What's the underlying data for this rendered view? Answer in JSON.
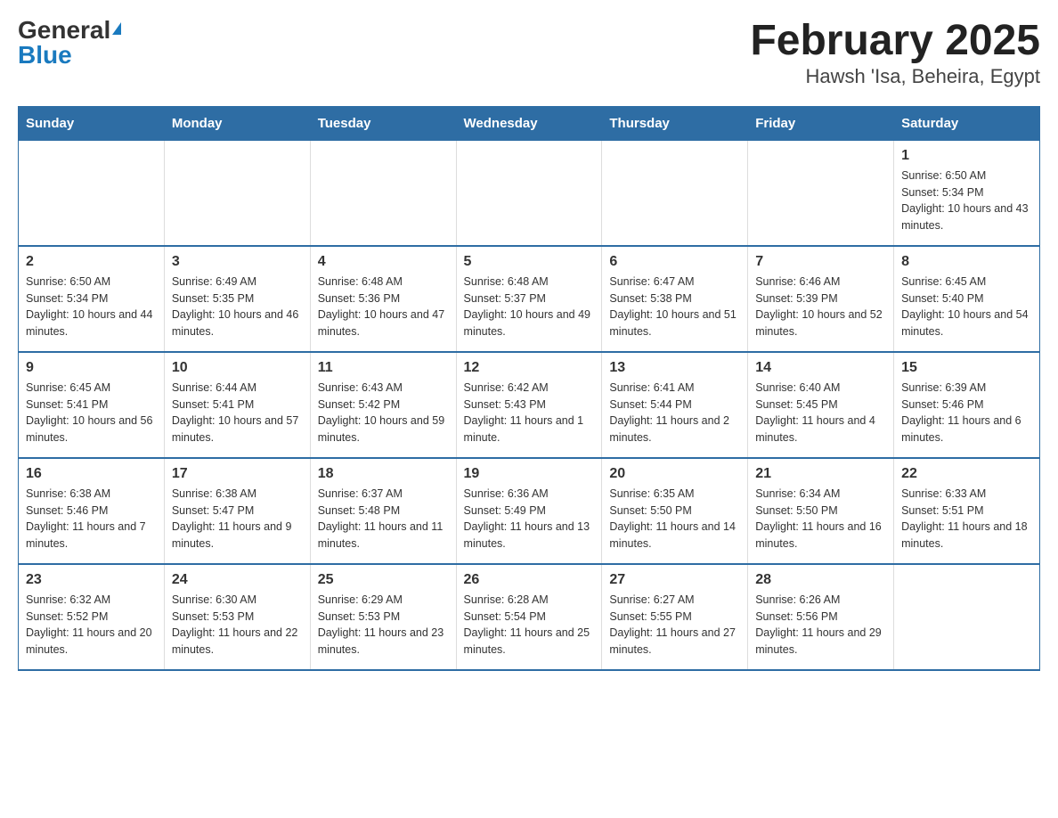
{
  "logo": {
    "general": "General",
    "blue": "Blue"
  },
  "title": "February 2025",
  "subtitle": "Hawsh 'Isa, Beheira, Egypt",
  "days": [
    "Sunday",
    "Monday",
    "Tuesday",
    "Wednesday",
    "Thursday",
    "Friday",
    "Saturday"
  ],
  "weeks": [
    [
      {
        "day": "",
        "sunrise": "",
        "sunset": "",
        "daylight": ""
      },
      {
        "day": "",
        "sunrise": "",
        "sunset": "",
        "daylight": ""
      },
      {
        "day": "",
        "sunrise": "",
        "sunset": "",
        "daylight": ""
      },
      {
        "day": "",
        "sunrise": "",
        "sunset": "",
        "daylight": ""
      },
      {
        "day": "",
        "sunrise": "",
        "sunset": "",
        "daylight": ""
      },
      {
        "day": "",
        "sunrise": "",
        "sunset": "",
        "daylight": ""
      },
      {
        "day": "1",
        "sunrise": "Sunrise: 6:50 AM",
        "sunset": "Sunset: 5:34 PM",
        "daylight": "Daylight: 10 hours and 43 minutes."
      }
    ],
    [
      {
        "day": "2",
        "sunrise": "Sunrise: 6:50 AM",
        "sunset": "Sunset: 5:34 PM",
        "daylight": "Daylight: 10 hours and 44 minutes."
      },
      {
        "day": "3",
        "sunrise": "Sunrise: 6:49 AM",
        "sunset": "Sunset: 5:35 PM",
        "daylight": "Daylight: 10 hours and 46 minutes."
      },
      {
        "day": "4",
        "sunrise": "Sunrise: 6:48 AM",
        "sunset": "Sunset: 5:36 PM",
        "daylight": "Daylight: 10 hours and 47 minutes."
      },
      {
        "day": "5",
        "sunrise": "Sunrise: 6:48 AM",
        "sunset": "Sunset: 5:37 PM",
        "daylight": "Daylight: 10 hours and 49 minutes."
      },
      {
        "day": "6",
        "sunrise": "Sunrise: 6:47 AM",
        "sunset": "Sunset: 5:38 PM",
        "daylight": "Daylight: 10 hours and 51 minutes."
      },
      {
        "day": "7",
        "sunrise": "Sunrise: 6:46 AM",
        "sunset": "Sunset: 5:39 PM",
        "daylight": "Daylight: 10 hours and 52 minutes."
      },
      {
        "day": "8",
        "sunrise": "Sunrise: 6:45 AM",
        "sunset": "Sunset: 5:40 PM",
        "daylight": "Daylight: 10 hours and 54 minutes."
      }
    ],
    [
      {
        "day": "9",
        "sunrise": "Sunrise: 6:45 AM",
        "sunset": "Sunset: 5:41 PM",
        "daylight": "Daylight: 10 hours and 56 minutes."
      },
      {
        "day": "10",
        "sunrise": "Sunrise: 6:44 AM",
        "sunset": "Sunset: 5:41 PM",
        "daylight": "Daylight: 10 hours and 57 minutes."
      },
      {
        "day": "11",
        "sunrise": "Sunrise: 6:43 AM",
        "sunset": "Sunset: 5:42 PM",
        "daylight": "Daylight: 10 hours and 59 minutes."
      },
      {
        "day": "12",
        "sunrise": "Sunrise: 6:42 AM",
        "sunset": "Sunset: 5:43 PM",
        "daylight": "Daylight: 11 hours and 1 minute."
      },
      {
        "day": "13",
        "sunrise": "Sunrise: 6:41 AM",
        "sunset": "Sunset: 5:44 PM",
        "daylight": "Daylight: 11 hours and 2 minutes."
      },
      {
        "day": "14",
        "sunrise": "Sunrise: 6:40 AM",
        "sunset": "Sunset: 5:45 PM",
        "daylight": "Daylight: 11 hours and 4 minutes."
      },
      {
        "day": "15",
        "sunrise": "Sunrise: 6:39 AM",
        "sunset": "Sunset: 5:46 PM",
        "daylight": "Daylight: 11 hours and 6 minutes."
      }
    ],
    [
      {
        "day": "16",
        "sunrise": "Sunrise: 6:38 AM",
        "sunset": "Sunset: 5:46 PM",
        "daylight": "Daylight: 11 hours and 7 minutes."
      },
      {
        "day": "17",
        "sunrise": "Sunrise: 6:38 AM",
        "sunset": "Sunset: 5:47 PM",
        "daylight": "Daylight: 11 hours and 9 minutes."
      },
      {
        "day": "18",
        "sunrise": "Sunrise: 6:37 AM",
        "sunset": "Sunset: 5:48 PM",
        "daylight": "Daylight: 11 hours and 11 minutes."
      },
      {
        "day": "19",
        "sunrise": "Sunrise: 6:36 AM",
        "sunset": "Sunset: 5:49 PM",
        "daylight": "Daylight: 11 hours and 13 minutes."
      },
      {
        "day": "20",
        "sunrise": "Sunrise: 6:35 AM",
        "sunset": "Sunset: 5:50 PM",
        "daylight": "Daylight: 11 hours and 14 minutes."
      },
      {
        "day": "21",
        "sunrise": "Sunrise: 6:34 AM",
        "sunset": "Sunset: 5:50 PM",
        "daylight": "Daylight: 11 hours and 16 minutes."
      },
      {
        "day": "22",
        "sunrise": "Sunrise: 6:33 AM",
        "sunset": "Sunset: 5:51 PM",
        "daylight": "Daylight: 11 hours and 18 minutes."
      }
    ],
    [
      {
        "day": "23",
        "sunrise": "Sunrise: 6:32 AM",
        "sunset": "Sunset: 5:52 PM",
        "daylight": "Daylight: 11 hours and 20 minutes."
      },
      {
        "day": "24",
        "sunrise": "Sunrise: 6:30 AM",
        "sunset": "Sunset: 5:53 PM",
        "daylight": "Daylight: 11 hours and 22 minutes."
      },
      {
        "day": "25",
        "sunrise": "Sunrise: 6:29 AM",
        "sunset": "Sunset: 5:53 PM",
        "daylight": "Daylight: 11 hours and 23 minutes."
      },
      {
        "day": "26",
        "sunrise": "Sunrise: 6:28 AM",
        "sunset": "Sunset: 5:54 PM",
        "daylight": "Daylight: 11 hours and 25 minutes."
      },
      {
        "day": "27",
        "sunrise": "Sunrise: 6:27 AM",
        "sunset": "Sunset: 5:55 PM",
        "daylight": "Daylight: 11 hours and 27 minutes."
      },
      {
        "day": "28",
        "sunrise": "Sunrise: 6:26 AM",
        "sunset": "Sunset: 5:56 PM",
        "daylight": "Daylight: 11 hours and 29 minutes."
      },
      {
        "day": "",
        "sunrise": "",
        "sunset": "",
        "daylight": ""
      }
    ]
  ]
}
